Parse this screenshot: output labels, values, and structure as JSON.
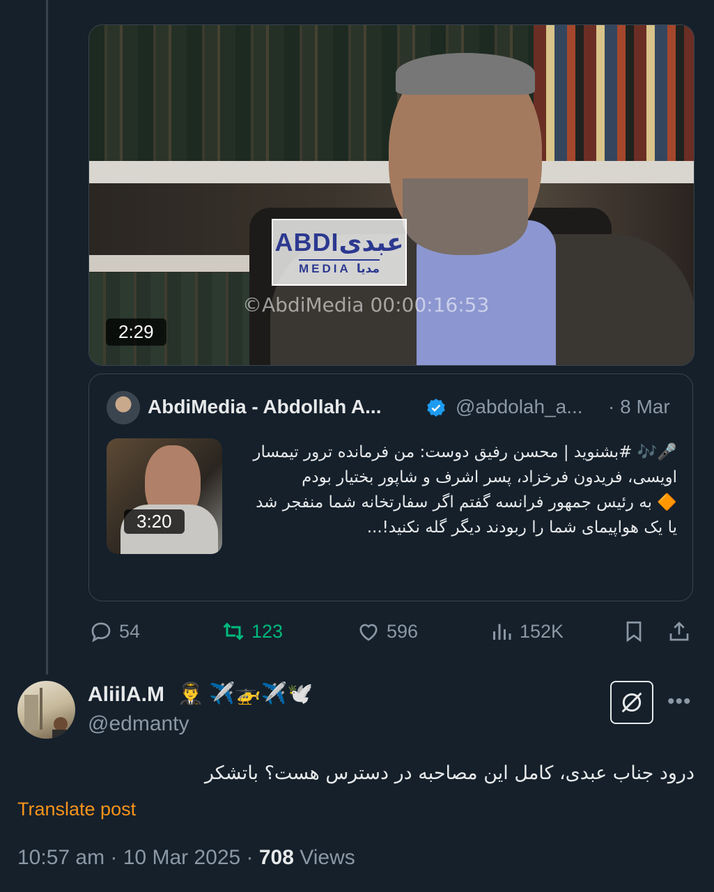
{
  "video": {
    "logo_main": "ABDIعبدی",
    "logo_sub": "MEDIA مدیا",
    "watermark": "©AbdiMedia 00:00:16:53",
    "duration": "2:29"
  },
  "quote": {
    "author_name": "AbdiMedia - Abdollah A...",
    "handle": "@abdolah_a...",
    "date": "· 8 Mar",
    "video_duration": "3:20",
    "text_line1": "🎤🎶 #بشنوید | محسن رفیق دوست: من فرمانده ترور تیمسار اویسی، فریدون فرخزاد، پسر اشرف و شاپور بختیار بودم",
    "text_line2": "🔶 به رئیس جمهور فرانسه گفتم اگر سفارتخانه شما منفجر شد یا یک هواپیمای شما را ربودند دیگر گله نکنید!...",
    "verified_color": "#1d9bf0"
  },
  "actions": {
    "replies": "54",
    "reposts": "123",
    "likes": "596",
    "views": "152K"
  },
  "reply": {
    "name": "AliilA.M",
    "emoji1": "👨‍✈️",
    "emoji2": "✈️🚁✈️🕊️",
    "handle": "@edmanty",
    "text": "درود جناب عبدی، کامل این مصاحبه در دسترس هست؟ باتشکر",
    "translate": "Translate post",
    "time": "10:57 am · 10 Mar 2025 · ",
    "views_count": "708",
    "views_label": " Views"
  },
  "colors": {
    "background": "#15202b",
    "repost_green": "#00ba7c",
    "translate_orange": "#f7931a"
  }
}
